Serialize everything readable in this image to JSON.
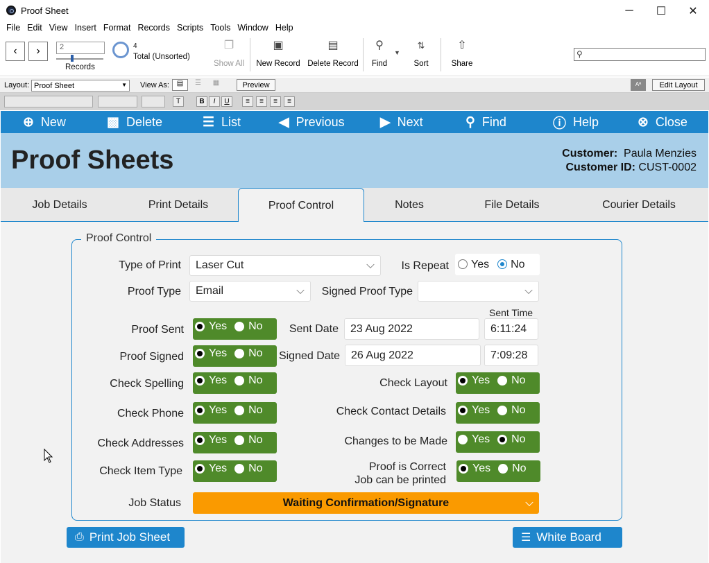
{
  "window": {
    "title": "Proof Sheet",
    "minimize": "─",
    "maximize": "☐",
    "close": "✕"
  },
  "menu": [
    "File",
    "Edit",
    "View",
    "Insert",
    "Format",
    "Records",
    "Scripts",
    "Tools",
    "Window",
    "Help"
  ],
  "toolbar": {
    "record_value": "2",
    "records_label": "Records",
    "found_count": "4",
    "total_label": "Total (Unsorted)",
    "show_all": "Show All",
    "new_record": "New Record",
    "delete_record": "Delete Record",
    "find": "Find",
    "sort": "Sort",
    "share": "Share"
  },
  "layoutbar": {
    "layout_label": "Layout:",
    "layout_value": "Proof Sheet",
    "view_as": "View As:",
    "preview": "Preview",
    "edit_layout": "Edit Layout"
  },
  "actions": {
    "new": "New",
    "delete": "Delete",
    "list": "List",
    "previous": "Previous",
    "next": "Next",
    "find": "Find",
    "help": "Help",
    "close": "Close"
  },
  "header": {
    "title": "Proof Sheets",
    "customer_label": "Customer:",
    "customer_value": "Paula Menzies",
    "customer_id_label": "Customer ID:",
    "customer_id_value": "CUST-0002"
  },
  "tabs": [
    "Job Details",
    "Print Details",
    "Proof Control",
    "Notes",
    "File Details",
    "Courier Details"
  ],
  "form": {
    "legend": "Proof Control",
    "type_of_print_label": "Type of Print",
    "type_of_print": "Laser Cut",
    "is_repeat_label": "Is Repeat",
    "yes": "Yes",
    "no": "No",
    "proof_type_label": "Proof Type",
    "proof_type": "Email",
    "signed_proof_type_label": "Signed Proof Type",
    "sent_time_label": "Sent Time",
    "proof_sent_label": "Proof Sent",
    "sent_date_label": "Sent Date",
    "sent_date": "23 Aug 2022",
    "sent_time": "6:11:24",
    "proof_signed_label": "Proof Signed",
    "signed_date_label": "Signed Date",
    "signed_date": "26 Aug 2022",
    "signed_time": "7:09:28",
    "check_spelling": "Check Spelling",
    "check_layout": "Check Layout",
    "check_phone": "Check Phone",
    "check_contact": "Check Contact Details",
    "check_addresses": "Check Addresses",
    "changes": "Changes to be Made",
    "check_item_type": "Check Item Type",
    "proof_correct_1": "Proof is Correct",
    "proof_correct_2": "Job can be printed",
    "job_status_label": "Job Status",
    "job_status": "Waiting Confirmation/Signature"
  },
  "buttons": {
    "print_job_sheet": "Print Job Sheet",
    "white_board": "White Board"
  },
  "colors": {
    "accent": "#1e86cc",
    "header": "#a9cfe9",
    "toggle": "#4f8a2a",
    "status": "#fa9a00"
  }
}
